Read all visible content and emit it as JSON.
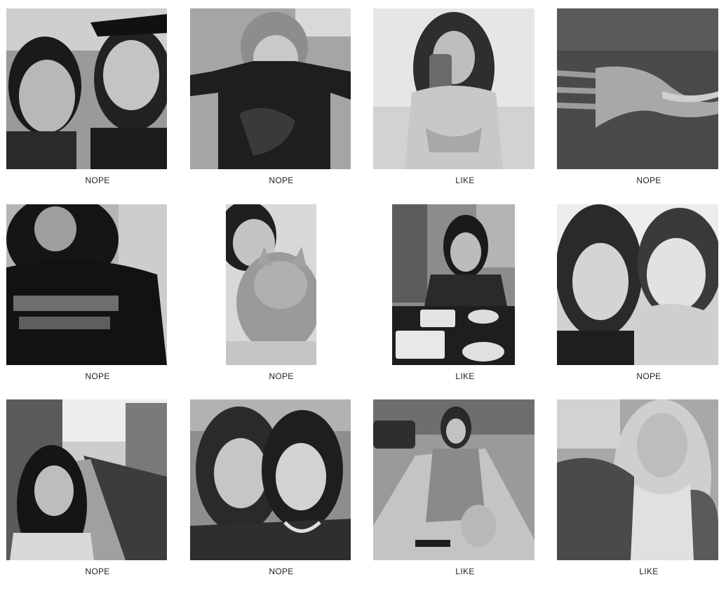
{
  "grid": {
    "items": [
      {
        "label": "NOPE",
        "image": "two-women-selfie-photo"
      },
      {
        "label": "NOPE",
        "image": "person-dark-tshirt-photo"
      },
      {
        "label": "LIKE",
        "image": "woman-with-shaker-bottle-photo"
      },
      {
        "label": "NOPE",
        "image": "fork-closeup-photo"
      },
      {
        "label": "NOPE",
        "image": "woman-madonna-tshirt-photo"
      },
      {
        "label": "NOPE",
        "image": "woman-with-cat-photo"
      },
      {
        "label": "LIKE",
        "image": "woman-at-restaurant-table-photo"
      },
      {
        "label": "NOPE",
        "image": "two-women-bright-selfie-photo"
      },
      {
        "label": "NOPE",
        "image": "woman-by-canal-photo"
      },
      {
        "label": "NOPE",
        "image": "two-women-portrait-photo"
      },
      {
        "label": "LIKE",
        "image": "woman-with-small-dog-photo"
      },
      {
        "label": "LIKE",
        "image": "blonde-woman-selfie-photo"
      }
    ]
  }
}
